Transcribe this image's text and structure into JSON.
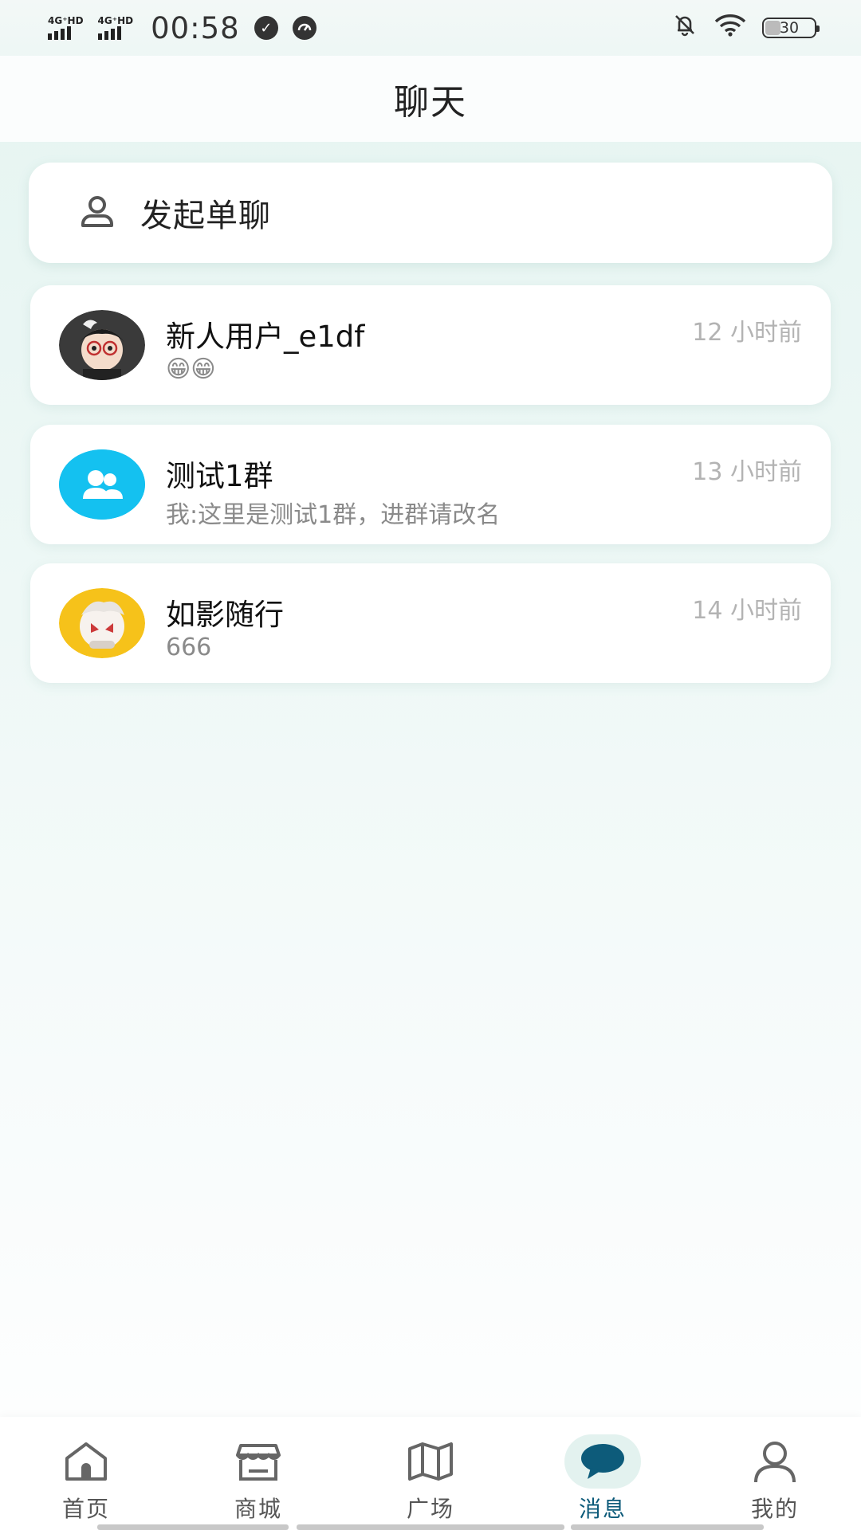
{
  "status_bar": {
    "signal1_label": "4G⁺HD",
    "signal2_label": "4G⁺HD",
    "time": "00:58",
    "battery": "30"
  },
  "header": {
    "title": "聊天"
  },
  "start_chat": {
    "label": "发起单聊",
    "icon": "person-icon"
  },
  "chats": [
    {
      "name": "新人用户_e1df",
      "preview": "😁😁",
      "time": "12 小时前",
      "avatar": "user-avatar"
    },
    {
      "name": "测试1群",
      "preview": "我:这里是测试1群，进群请改名",
      "time": "13 小时前",
      "avatar": "group-avatar"
    },
    {
      "name": "如影随行",
      "preview": "666",
      "time": "14 小时前",
      "avatar": "user-avatar"
    }
  ],
  "bottom_nav": {
    "items": [
      {
        "label": "首页",
        "icon": "home-icon"
      },
      {
        "label": "商城",
        "icon": "store-icon"
      },
      {
        "label": "广场",
        "icon": "map-icon"
      },
      {
        "label": "消息",
        "icon": "chat-bubble-icon",
        "active": true
      },
      {
        "label": "我的",
        "icon": "profile-icon"
      }
    ]
  },
  "colors": {
    "accent": "#0d5b7a",
    "group_avatar_bg": "#14c1f0",
    "time_text": "#b3b3b3"
  }
}
